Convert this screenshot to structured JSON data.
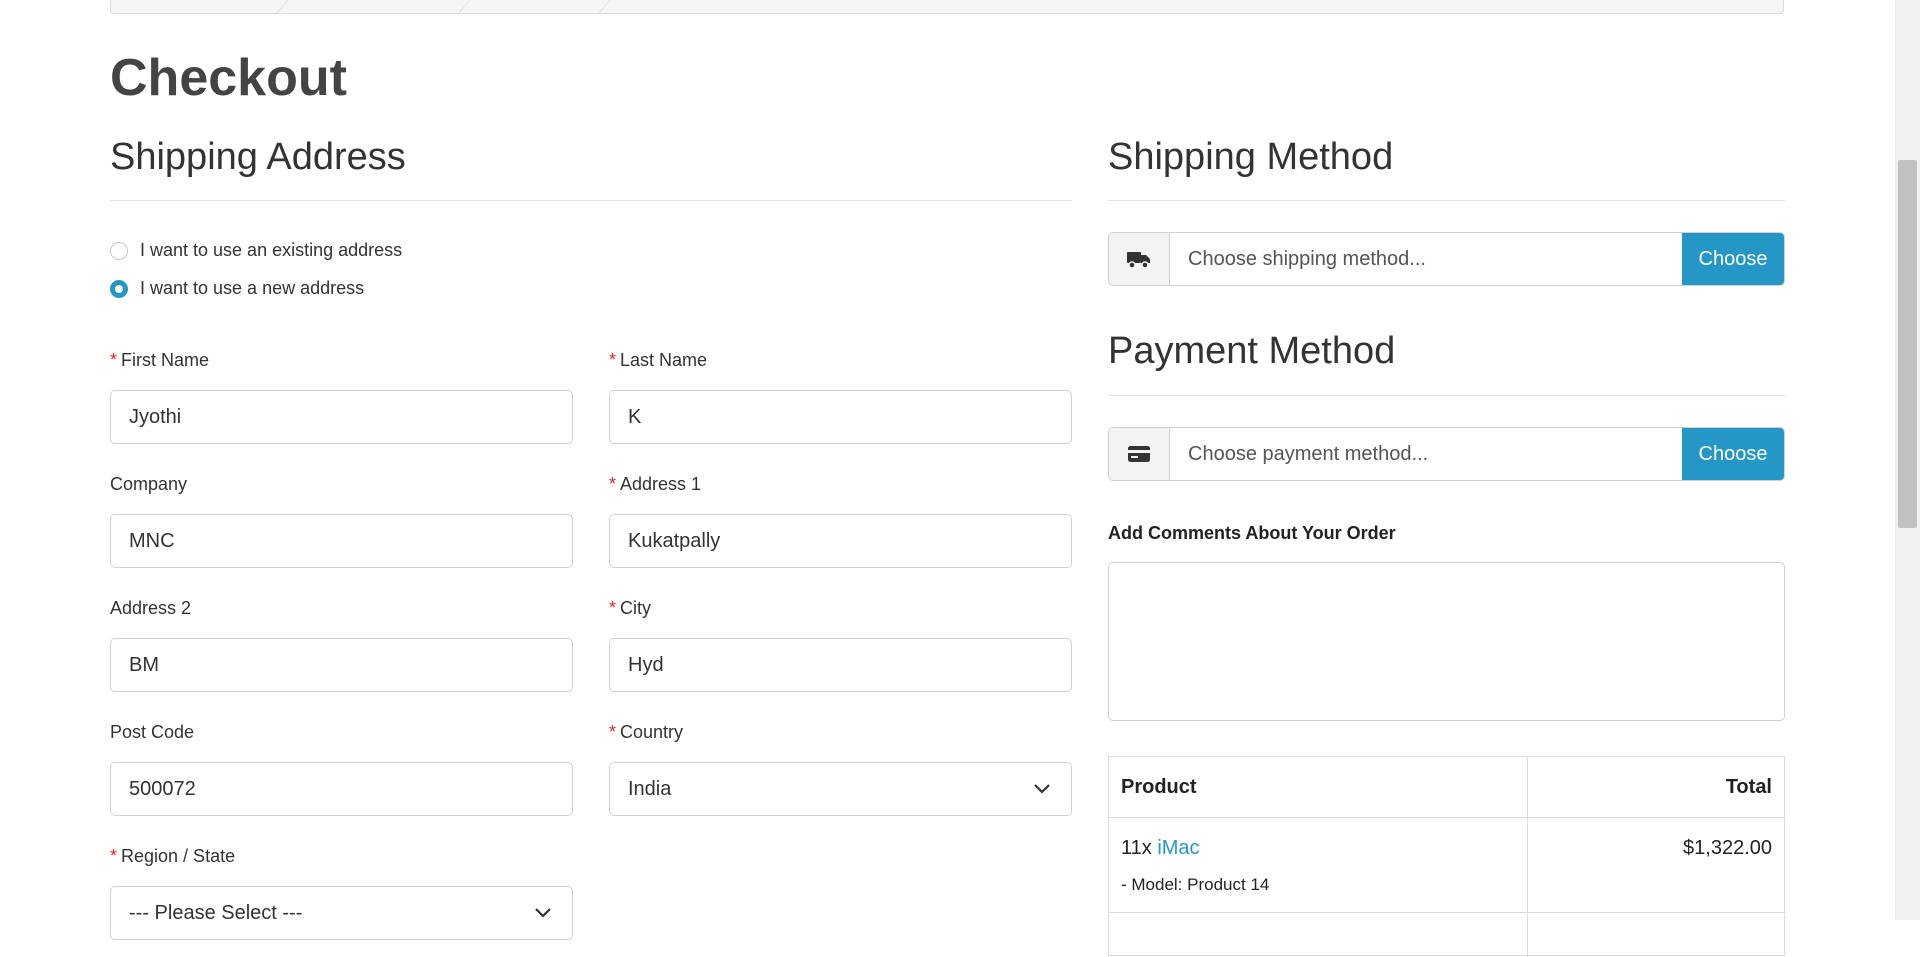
{
  "page": {
    "title": "Checkout"
  },
  "shipping_address": {
    "title": "Shipping Address",
    "options": [
      {
        "label": "I want to use an existing address",
        "checked": false
      },
      {
        "label": "I want to use a new address",
        "checked": true
      }
    ],
    "fields": {
      "first_name": {
        "label": "First Name",
        "required": true,
        "value": "Jyothi"
      },
      "last_name": {
        "label": "Last Name",
        "required": true,
        "value": "K"
      },
      "company": {
        "label": "Company",
        "required": false,
        "value": "MNC"
      },
      "address_1": {
        "label": "Address 1",
        "required": true,
        "value": "Kukatpally"
      },
      "address_2": {
        "label": "Address 2",
        "required": false,
        "value": "BM"
      },
      "city": {
        "label": "City",
        "required": true,
        "value": "Hyd"
      },
      "post_code": {
        "label": "Post Code",
        "required": false,
        "value": "500072"
      },
      "country": {
        "label": "Country",
        "required": true,
        "value": "India"
      },
      "region": {
        "label": "Region / State",
        "required": true,
        "value": "--- Please Select ---"
      }
    }
  },
  "shipping_method": {
    "title": "Shipping Method",
    "placeholder": "Choose shipping method...",
    "button": "Choose",
    "icon": "truck-icon"
  },
  "payment_method": {
    "title": "Payment Method",
    "placeholder": "Choose payment method...",
    "button": "Choose",
    "icon": "credit-card-icon"
  },
  "comments": {
    "label": "Add Comments About Your Order",
    "value": ""
  },
  "order_table": {
    "headers": {
      "product": "Product",
      "total": "Total"
    },
    "rows": [
      {
        "qty": "11x",
        "name": "iMac",
        "model": "- Model: Product 14",
        "total": "$1,322.00"
      }
    ]
  },
  "colors": {
    "accent": "#2497c6",
    "required": "#e3262e"
  }
}
